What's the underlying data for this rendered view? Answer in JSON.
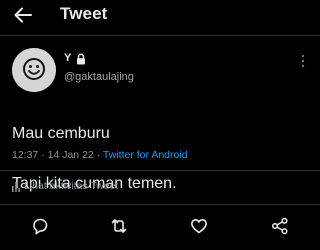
{
  "header": {
    "title": "Tweet",
    "back_icon": "arrow-left-icon"
  },
  "tweet": {
    "author_name": "Y",
    "protected_icon": "lock-icon",
    "handle": "@gaktaulajing",
    "text_lines": [
      "Mau cemburu",
      "Tapi kita cuman temen."
    ],
    "time": "12:37",
    "separator": "·",
    "date": "14 Jan 22",
    "source": "Twitter for Android",
    "activity_label": "Lihat aktivitas Tweet",
    "activity_icon": "bar-chart-icon",
    "more_icon": "more-vertical-icon"
  },
  "actions": [
    {
      "name": "reply",
      "icon": "reply-bubble-icon"
    },
    {
      "name": "retweet",
      "icon": "retweet-icon"
    },
    {
      "name": "like",
      "icon": "heart-icon"
    },
    {
      "name": "share",
      "icon": "share-icon"
    }
  ],
  "colors": {
    "background": "#000000",
    "text": "#e7e9ea",
    "secondary_text": "#8b9197",
    "accent": "#1d9bf0",
    "divider": "#2f3336",
    "avatar_bg": "#d9d9d9"
  }
}
